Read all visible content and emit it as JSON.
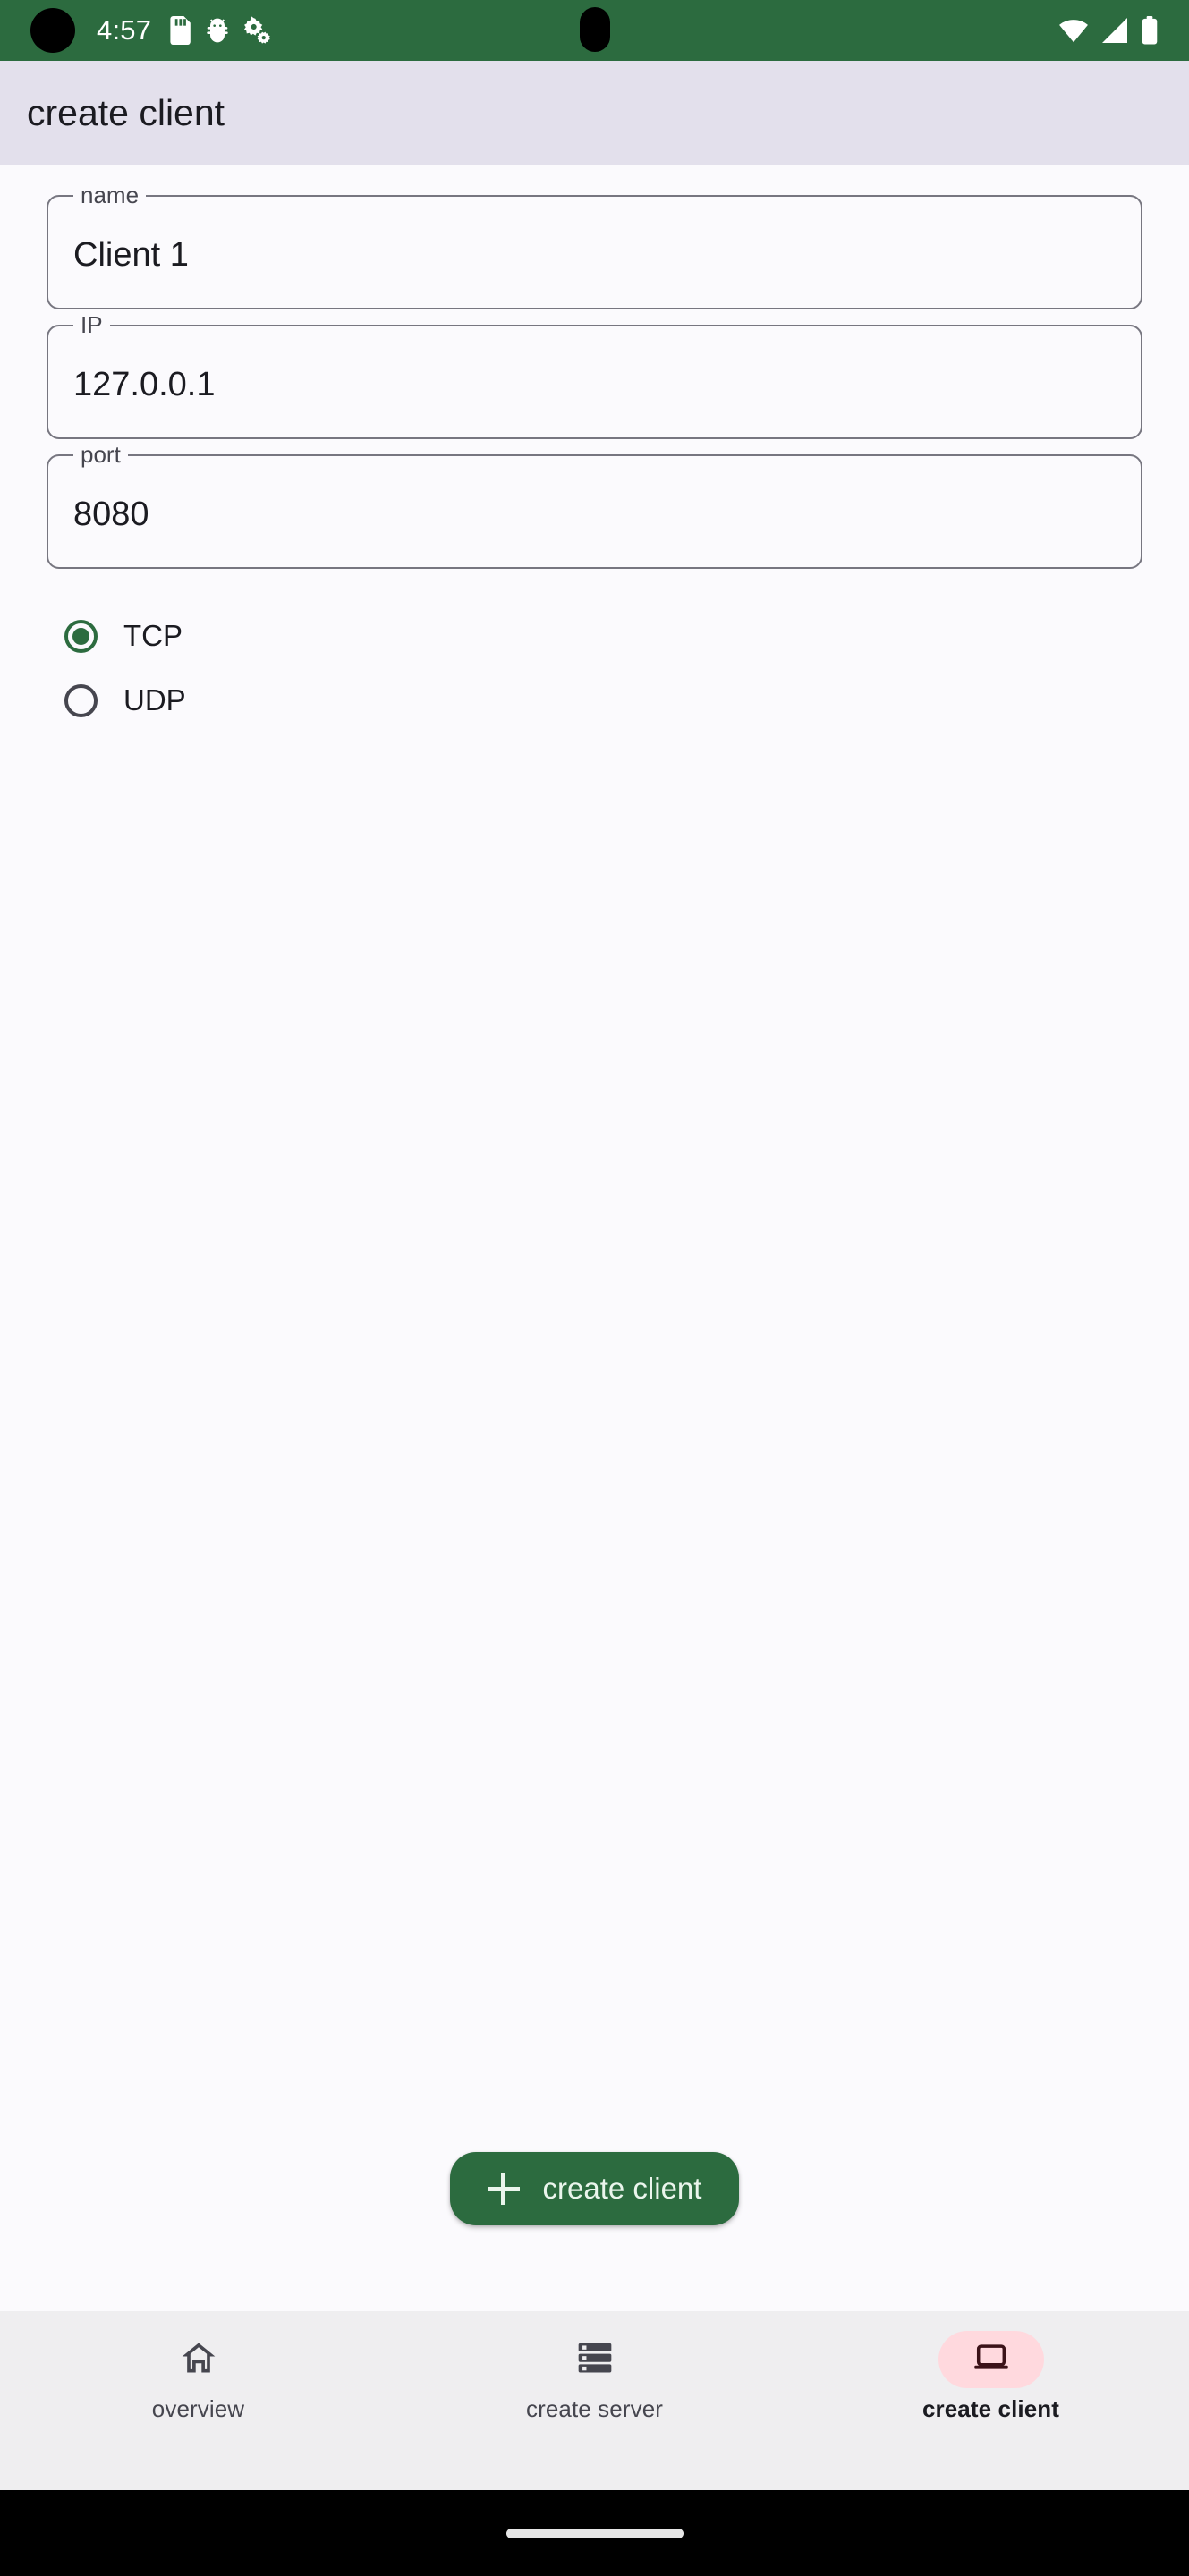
{
  "status_bar": {
    "time": "4:57",
    "background_color": "#2C6B3F",
    "icons_left": [
      "sd-card-icon",
      "android-debug-icon",
      "settings-gears-icon"
    ],
    "icons_right": [
      "wifi-icon",
      "cellular-signal-icon",
      "battery-icon"
    ]
  },
  "app_bar": {
    "title": "create client",
    "background_color": "#E3E0EC"
  },
  "form": {
    "fields": [
      {
        "label": "name",
        "value": "Client 1",
        "placeholder": "name"
      },
      {
        "label": "IP",
        "value": "127.0.0.1",
        "placeholder": "IP"
      },
      {
        "label": "port",
        "value": "8080",
        "placeholder": "port"
      }
    ],
    "protocol": {
      "selected": "TCP",
      "options": [
        {
          "label": "TCP",
          "checked": true
        },
        {
          "label": "UDP",
          "checked": false
        }
      ]
    }
  },
  "fab": {
    "label": "create client",
    "icon": "plus-icon",
    "background_color": "#2C6B3F",
    "text_color": "#EAF5EC"
  },
  "bottom_nav": {
    "active_index": 2,
    "indicator_color": "#FFD9DE",
    "items": [
      {
        "label": "overview",
        "icon": "home-icon",
        "active": false
      },
      {
        "label": "create server",
        "icon": "dns-server-icon",
        "active": false
      },
      {
        "label": "create client",
        "icon": "laptop-icon",
        "active": true
      }
    ]
  }
}
